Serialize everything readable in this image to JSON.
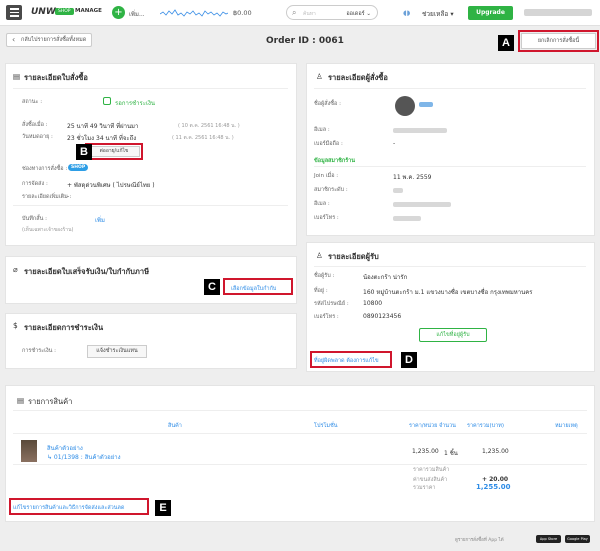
{
  "topbar": {
    "logo": "UNW",
    "logo_badge": "SHOP",
    "logo_sub": "MANAGE",
    "add_label": "เพิ่ม...",
    "balance": "฿0.00",
    "search_placeholder": "ค้นหา",
    "search_scope": "ออเดอร์ ⌄",
    "help": "ช่วยเหลือ ▾",
    "upgrade": "Upgrade"
  },
  "header": {
    "back": "กลับไปรายการสั่งซื้อทั้งหมด",
    "order_id": "Order ID : 0061",
    "cancel": "ยกเลิกการสั่งซื้อนี้"
  },
  "order_details": {
    "title": "รายละเอียดใบสั่งซื้อ",
    "status_label": "สถานะ :",
    "status_value": "รอการชำระเงิน",
    "ordered_label": "สั่งซื้อเมื่อ :",
    "ordered_value": "25 นาที 49 วินาที ที่ผ่านมา",
    "ordered_date": "( 10 ต.ค. 2561 16:48 น. )",
    "expire_label": "วันหมดอายุ :",
    "expire_value": "23 ชั่วโมง 34 นาที ที่จะถึง",
    "expire_date": "( 11 ต.ค. 2561 16:48 น. )",
    "extend_btn": "ต่ออายุ/แก้ไข",
    "channel_label": "ช่องทางการสั่งซื้อ :",
    "channel_value": "SHOP",
    "delivery_label": "การจัดส่ง :",
    "delivery_value": "+ พัสดุด่วนพิเศษ ( ไปรษณีย์ไทย )",
    "extra_label": "รายละเอียดเพิ่มเติม :",
    "extra_value": "-",
    "note_label": "บันทึกสั้น :",
    "note_sub": "(เห็นเฉพาะเจ้าของร้าน)",
    "note_add": "เพิ่ม"
  },
  "invoice": {
    "title": "รายละเอียดใบเสร็จรับเงิน/ใบกำกับภาษี",
    "select_btn": "เลือกข้อมูลใบกำกับ"
  },
  "payment": {
    "title": "รายละเอียดการชำระเงิน",
    "label": "การชำระเงิน :",
    "notify_btn": "แจ้งชำระเงินแทน"
  },
  "buyer": {
    "title": "รายละเอียดผู้สั่งซื้อ",
    "name_label": "ชื่อผู้สั่งซื้อ :",
    "email_label": "อีเมล :",
    "phone_label": "เบอร์มือถือ :",
    "phone_value": "-",
    "member_title": "ข้อมูลสมาชิกร้าน",
    "join_label": "Join เมื่อ :",
    "join_value": "11 พ.ค. 2559",
    "level_label": "สมาชิกระดับ :",
    "m_email_label": "อีเมล :",
    "m_phone_label": "เบอร์โทร :"
  },
  "receiver": {
    "title": "รายละเอียดผู้รับ",
    "name_label": "ชื่อผู้รับ :",
    "name_value": "น้องตะกร้า น่ารัก",
    "addr_label": "ที่อยู่ :",
    "addr_value": "160 หมู่บ้านตะกร้า ม.1 แขวงบางซื่อ เขตบางซื่อ กรุงเทพมหานคร",
    "zip_label": "รหัสไปรษณีย์ :",
    "zip_value": "10800",
    "tel_label": "เบอร์โทร :",
    "tel_value": "0890123456",
    "edit_btn": "แก้ไขที่อยู่ผู้รับ",
    "wrong_addr": "ที่อยู่ผิดพลาด ต้องการแก้ไข"
  },
  "products": {
    "title": "รายการสินค้า",
    "headers": {
      "product": "สินค้า",
      "promo": "โปรโมชั่น",
      "unit_price": "ราคา/หน่วย",
      "qty": "จำนวน",
      "total": "ราคารวม(บาท)",
      "note": "หมายเหตุ"
    },
    "item_name": "สินค้าตัวอย่าง",
    "item_sub": "↳ 01/1398 : สินค้าตัวอย่าง",
    "item_price": "1,235.00",
    "item_qty": "1 ชิ้น",
    "item_total": "1,235.00",
    "sum_label": "ราคารวมสินค้า",
    "sum_value": "1,235.00",
    "ship_label": "ค่าขนส่งสินค้า",
    "ship_value": "+ 20.00",
    "grand_label": "รวมราคา",
    "grand_value": "1,255.00",
    "edit_link": "แก้ไขรายการสินค้าและวิธีการจัดส่งและส่วนลด"
  },
  "footer": {
    "text": "ดูรายการสั่งซื้อที่ App ได้",
    "app_store": "App Store",
    "google_play": "Google Play"
  },
  "markers": {
    "a": "A",
    "b": "B",
    "c": "C",
    "d": "D",
    "e": "E"
  },
  "colors": {
    "accent": "#2fb344",
    "link": "#2e8ce6",
    "highlight": "#d0162d"
  }
}
